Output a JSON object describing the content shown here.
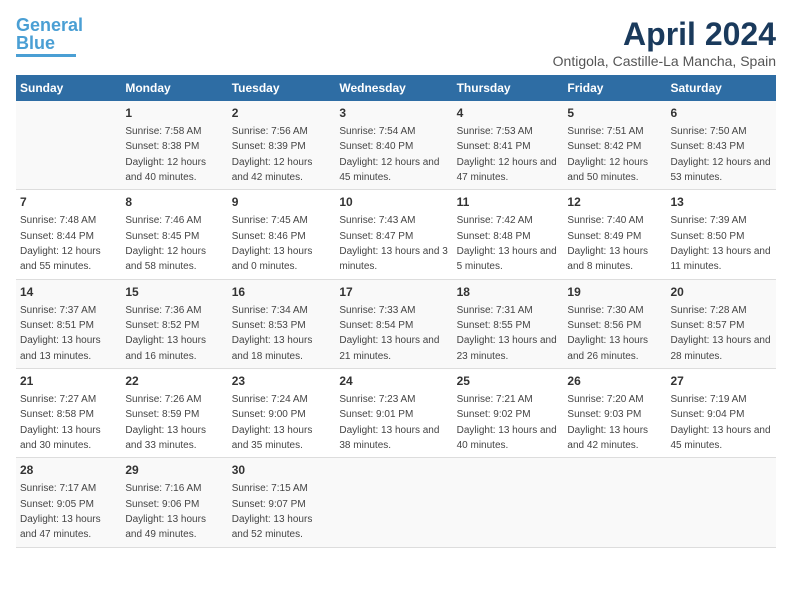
{
  "logo": {
    "line1": "General",
    "line2": "Blue"
  },
  "title": "April 2024",
  "subtitle": "Ontigola, Castille-La Mancha, Spain",
  "days_of_week": [
    "Sunday",
    "Monday",
    "Tuesday",
    "Wednesday",
    "Thursday",
    "Friday",
    "Saturday"
  ],
  "weeks": [
    [
      {
        "day": "",
        "sunrise": "",
        "sunset": "",
        "daylight": ""
      },
      {
        "day": "1",
        "sunrise": "7:58 AM",
        "sunset": "8:38 PM",
        "daylight": "12 hours and 40 minutes."
      },
      {
        "day": "2",
        "sunrise": "7:56 AM",
        "sunset": "8:39 PM",
        "daylight": "12 hours and 42 minutes."
      },
      {
        "day": "3",
        "sunrise": "7:54 AM",
        "sunset": "8:40 PM",
        "daylight": "12 hours and 45 minutes."
      },
      {
        "day": "4",
        "sunrise": "7:53 AM",
        "sunset": "8:41 PM",
        "daylight": "12 hours and 47 minutes."
      },
      {
        "day": "5",
        "sunrise": "7:51 AM",
        "sunset": "8:42 PM",
        "daylight": "12 hours and 50 minutes."
      },
      {
        "day": "6",
        "sunrise": "7:50 AM",
        "sunset": "8:43 PM",
        "daylight": "12 hours and 53 minutes."
      }
    ],
    [
      {
        "day": "7",
        "sunrise": "7:48 AM",
        "sunset": "8:44 PM",
        "daylight": "12 hours and 55 minutes."
      },
      {
        "day": "8",
        "sunrise": "7:46 AM",
        "sunset": "8:45 PM",
        "daylight": "12 hours and 58 minutes."
      },
      {
        "day": "9",
        "sunrise": "7:45 AM",
        "sunset": "8:46 PM",
        "daylight": "13 hours and 0 minutes."
      },
      {
        "day": "10",
        "sunrise": "7:43 AM",
        "sunset": "8:47 PM",
        "daylight": "13 hours and 3 minutes."
      },
      {
        "day": "11",
        "sunrise": "7:42 AM",
        "sunset": "8:48 PM",
        "daylight": "13 hours and 5 minutes."
      },
      {
        "day": "12",
        "sunrise": "7:40 AM",
        "sunset": "8:49 PM",
        "daylight": "13 hours and 8 minutes."
      },
      {
        "day": "13",
        "sunrise": "7:39 AM",
        "sunset": "8:50 PM",
        "daylight": "13 hours and 11 minutes."
      }
    ],
    [
      {
        "day": "14",
        "sunrise": "7:37 AM",
        "sunset": "8:51 PM",
        "daylight": "13 hours and 13 minutes."
      },
      {
        "day": "15",
        "sunrise": "7:36 AM",
        "sunset": "8:52 PM",
        "daylight": "13 hours and 16 minutes."
      },
      {
        "day": "16",
        "sunrise": "7:34 AM",
        "sunset": "8:53 PM",
        "daylight": "13 hours and 18 minutes."
      },
      {
        "day": "17",
        "sunrise": "7:33 AM",
        "sunset": "8:54 PM",
        "daylight": "13 hours and 21 minutes."
      },
      {
        "day": "18",
        "sunrise": "7:31 AM",
        "sunset": "8:55 PM",
        "daylight": "13 hours and 23 minutes."
      },
      {
        "day": "19",
        "sunrise": "7:30 AM",
        "sunset": "8:56 PM",
        "daylight": "13 hours and 26 minutes."
      },
      {
        "day": "20",
        "sunrise": "7:28 AM",
        "sunset": "8:57 PM",
        "daylight": "13 hours and 28 minutes."
      }
    ],
    [
      {
        "day": "21",
        "sunrise": "7:27 AM",
        "sunset": "8:58 PM",
        "daylight": "13 hours and 30 minutes."
      },
      {
        "day": "22",
        "sunrise": "7:26 AM",
        "sunset": "8:59 PM",
        "daylight": "13 hours and 33 minutes."
      },
      {
        "day": "23",
        "sunrise": "7:24 AM",
        "sunset": "9:00 PM",
        "daylight": "13 hours and 35 minutes."
      },
      {
        "day": "24",
        "sunrise": "7:23 AM",
        "sunset": "9:01 PM",
        "daylight": "13 hours and 38 minutes."
      },
      {
        "day": "25",
        "sunrise": "7:21 AM",
        "sunset": "9:02 PM",
        "daylight": "13 hours and 40 minutes."
      },
      {
        "day": "26",
        "sunrise": "7:20 AM",
        "sunset": "9:03 PM",
        "daylight": "13 hours and 42 minutes."
      },
      {
        "day": "27",
        "sunrise": "7:19 AM",
        "sunset": "9:04 PM",
        "daylight": "13 hours and 45 minutes."
      }
    ],
    [
      {
        "day": "28",
        "sunrise": "7:17 AM",
        "sunset": "9:05 PM",
        "daylight": "13 hours and 47 minutes."
      },
      {
        "day": "29",
        "sunrise": "7:16 AM",
        "sunset": "9:06 PM",
        "daylight": "13 hours and 49 minutes."
      },
      {
        "day": "30",
        "sunrise": "7:15 AM",
        "sunset": "9:07 PM",
        "daylight": "13 hours and 52 minutes."
      },
      {
        "day": "",
        "sunrise": "",
        "sunset": "",
        "daylight": ""
      },
      {
        "day": "",
        "sunrise": "",
        "sunset": "",
        "daylight": ""
      },
      {
        "day": "",
        "sunrise": "",
        "sunset": "",
        "daylight": ""
      },
      {
        "day": "",
        "sunrise": "",
        "sunset": "",
        "daylight": ""
      }
    ]
  ]
}
